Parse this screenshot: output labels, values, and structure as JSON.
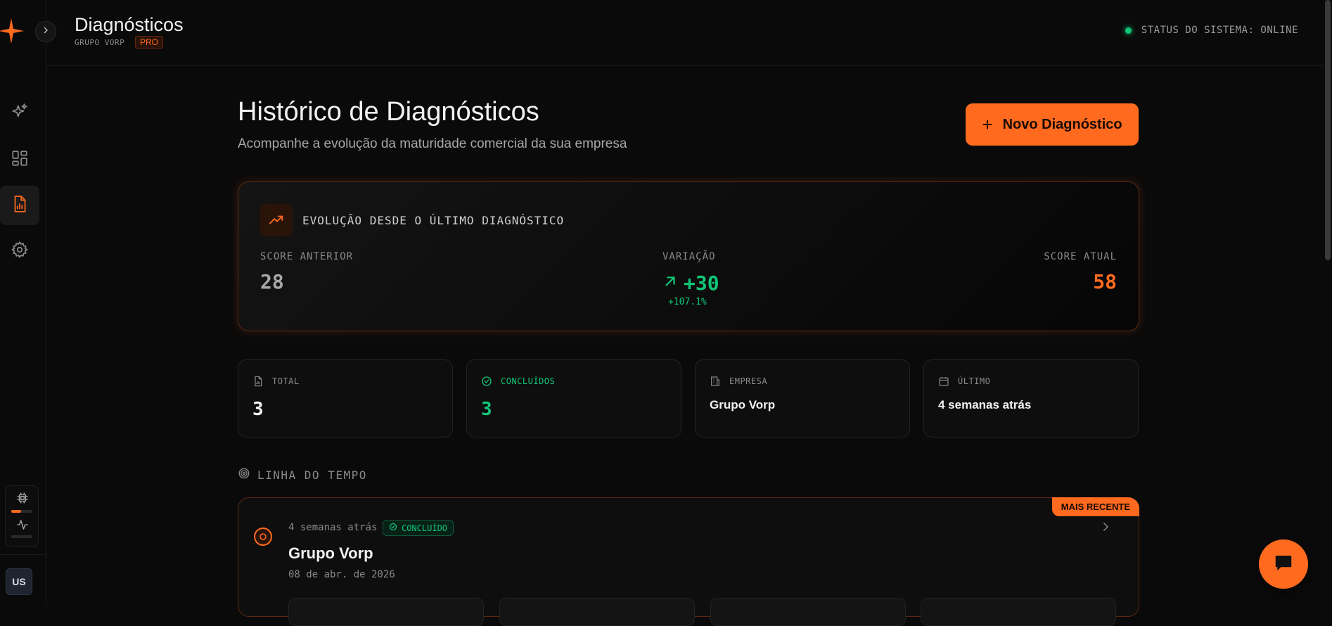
{
  "app": {
    "title": "Diagnósticos",
    "org": "GRUPO VORP",
    "plan_badge": "PRO"
  },
  "status": {
    "text": "STATUS DO SISTEMA: ONLINE",
    "color": "#10c778"
  },
  "sidebar": {
    "items": [
      {
        "name": "ai-sparkles"
      },
      {
        "name": "dashboard"
      },
      {
        "name": "reports",
        "active": true
      },
      {
        "name": "settings"
      }
    ],
    "avatar_initials": "US"
  },
  "page": {
    "title": "Histórico de Diagnósticos",
    "subtitle": "Acompanhe a evolução da maturidade comercial da sua empresa",
    "new_button_label": "Novo Diagnóstico"
  },
  "evolution": {
    "title": "EVOLUÇÃO DESDE O ÚLTIMO DIAGNÓSTICO",
    "previous_label": "SCORE ANTERIOR",
    "previous_value": "28",
    "variation_label": "VARIAÇÃO",
    "variation_value": "+30",
    "variation_percent": "+107.1%",
    "current_label": "SCORE ATUAL",
    "current_value": "58"
  },
  "stats": {
    "total_label": "TOTAL",
    "total_value": "3",
    "completed_label": "CONCLUÍDOS",
    "completed_value": "3",
    "company_label": "EMPRESA",
    "company_value": "Grupo Vorp",
    "last_label": "ÚLTIMO",
    "last_value": "4 semanas atrás"
  },
  "timeline": {
    "heading": "LINHA DO TEMPO",
    "entries": [
      {
        "badge": "MAIS RECENTE",
        "relative_time": "4 semanas atrás",
        "status": "CONCLUÍDO",
        "company": "Grupo Vorp",
        "date": "08 de abr. de 2026"
      }
    ]
  },
  "colors": {
    "accent": "#ff6a1f",
    "success": "#10c778",
    "background": "#0a0a0a"
  }
}
